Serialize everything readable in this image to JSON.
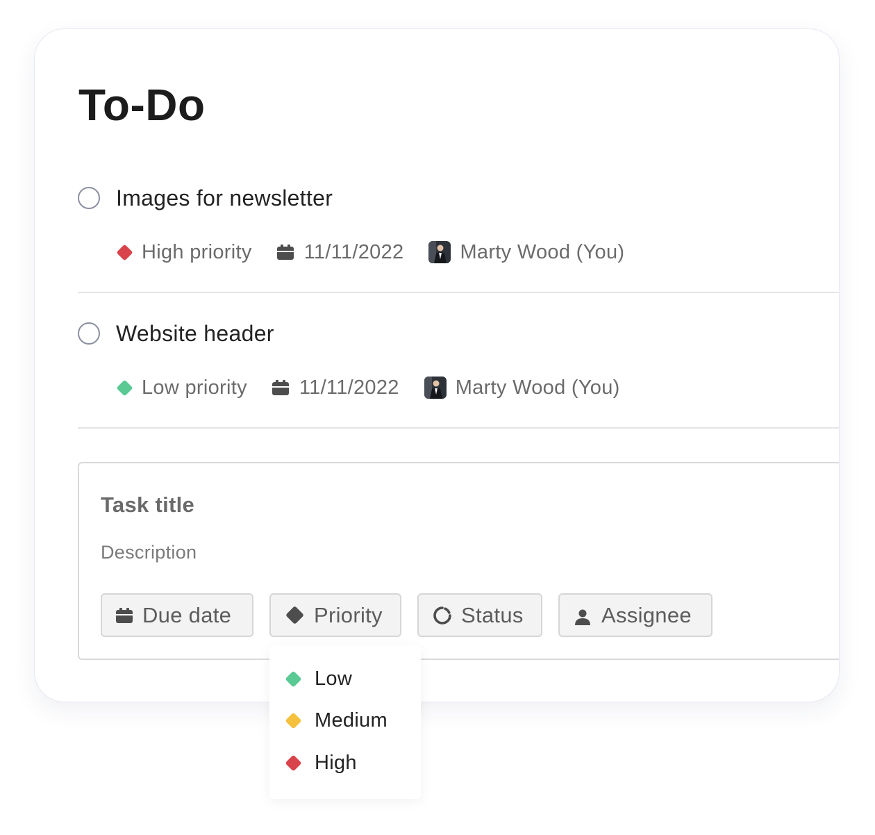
{
  "title": "To-Do",
  "colors": {
    "high": "#d9434b",
    "medium": "#f4c03e",
    "low": "#5bc994"
  },
  "tasks": [
    {
      "title": "Images for newsletter",
      "priority_label": "High priority",
      "priority_color": "#d9434b",
      "due_date": "11/11/2022",
      "assignee": "Marty Wood (You)"
    },
    {
      "title": "Website header",
      "priority_label": "Low priority",
      "priority_color": "#5bc994",
      "due_date": "11/11/2022",
      "assignee": "Marty Wood (You)"
    }
  ],
  "composer": {
    "title_placeholder": "Task title",
    "description_placeholder": "Description",
    "chips": {
      "due_date": "Due date",
      "priority": "Priority",
      "status": "Status",
      "assignee": "Assignee"
    }
  },
  "priority_menu": {
    "options": [
      {
        "label": "Low",
        "color": "#5bc994"
      },
      {
        "label": "Medium",
        "color": "#f4c03e"
      },
      {
        "label": "High",
        "color": "#d9434b"
      }
    ]
  },
  "icons": {
    "due_date": "calendar-icon",
    "priority": "diamond-icon",
    "status": "status-spinner-icon",
    "assignee": "person-icon"
  }
}
